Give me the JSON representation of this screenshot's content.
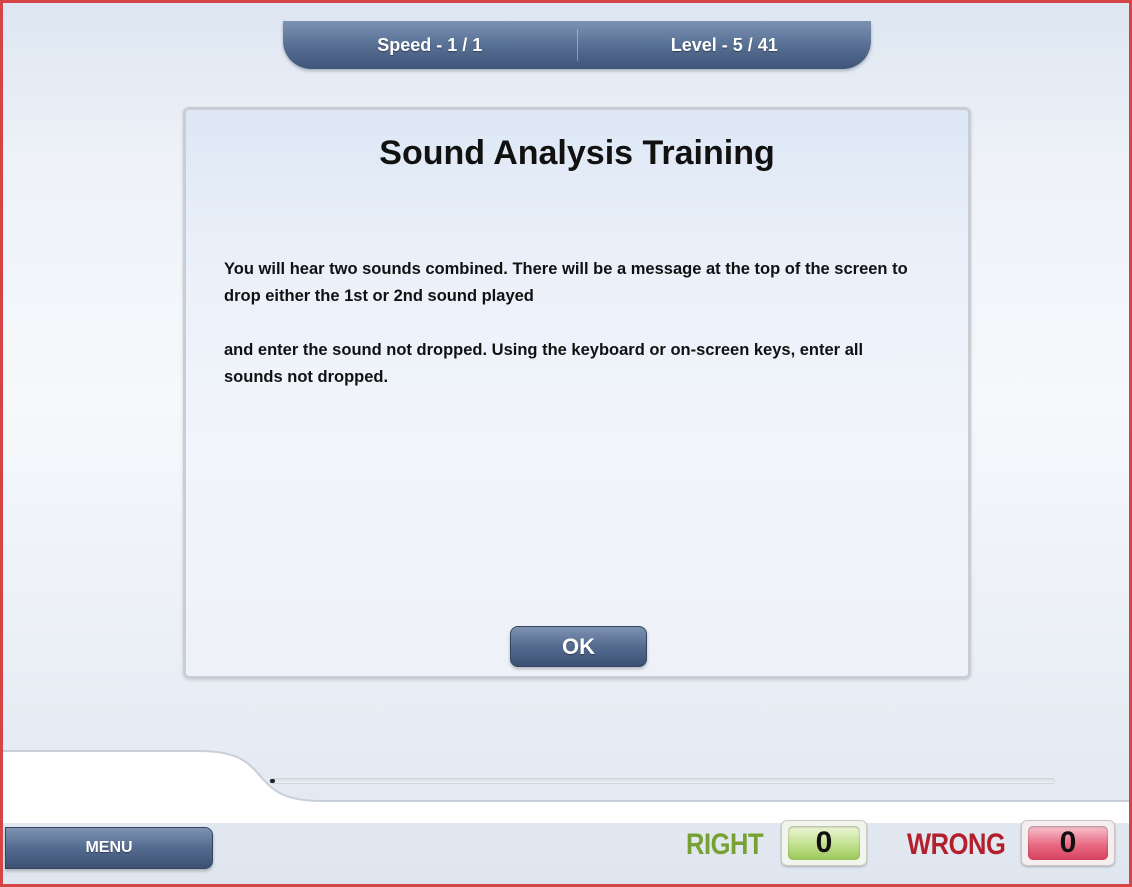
{
  "status": {
    "speed_label": "Speed - 1 / 1",
    "level_label": "Level - 5 / 41"
  },
  "dialog": {
    "title": "Sound Analysis Training",
    "paragraph1": "You will hear two sounds combined.  There will be a message at the top of the screen to drop either the 1st or 2nd sound played",
    "paragraph2": "and enter the sound not dropped.  Using the keyboard or on-screen keys, enter all sounds not dropped.",
    "ok_label": "OK"
  },
  "progress": {
    "fraction": 0.006
  },
  "footer": {
    "menu_label": "MENU",
    "right_label": "RIGHT",
    "right_count": "0",
    "wrong_label": "WRONG",
    "wrong_count": "0"
  },
  "colors": {
    "frame_border": "#d64545",
    "button_blue": "#546b90",
    "right_green": "#77a233",
    "wrong_red": "#b3202c"
  }
}
